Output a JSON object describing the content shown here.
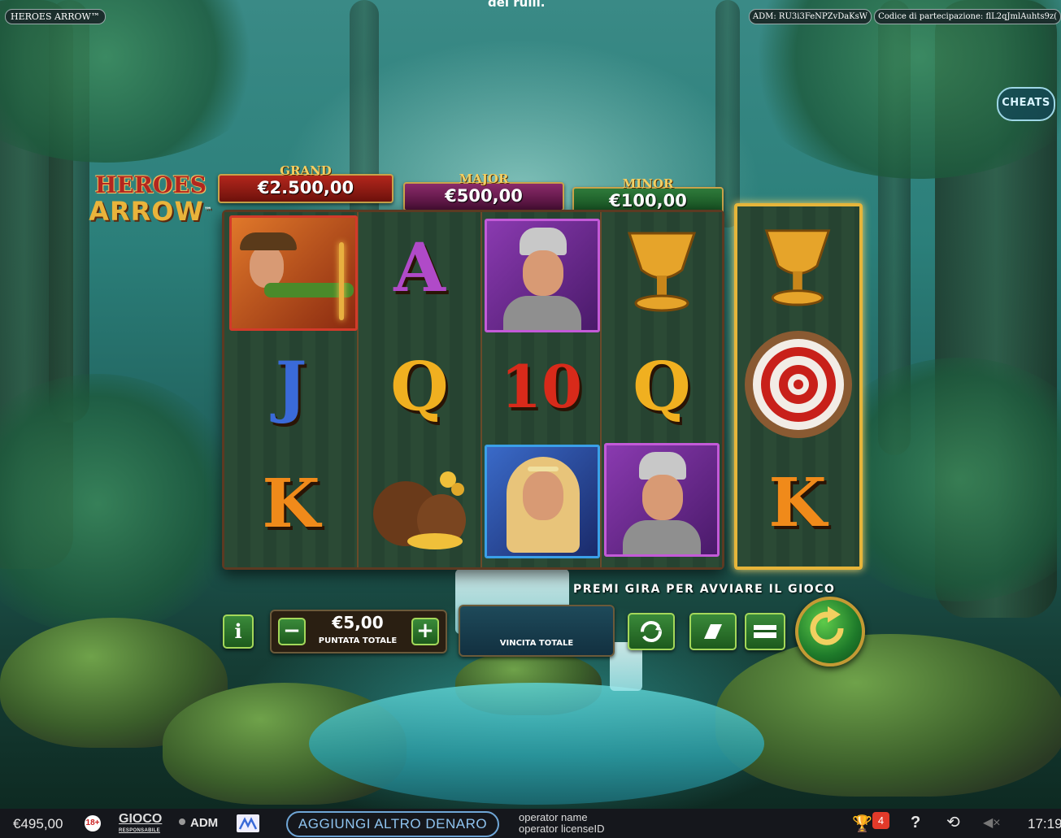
{
  "window": {
    "title": "HEROES ARROW™",
    "adm_code": "ADM: RU3i3FeNPZvDaKsW",
    "participation_code": "Codice di partecipazione: flL2qJmlAuhts9z(",
    "top_message": "del rulli."
  },
  "cheats_label": "CHEATS",
  "logo": {
    "line1": "HEROES",
    "line2": "ARROW"
  },
  "jackpots": [
    {
      "name": "GRAND",
      "value": "€2.500,00",
      "color": "#8e1a12"
    },
    {
      "name": "MAJOR",
      "value": "€500,00",
      "color": "#6a1a4a"
    },
    {
      "name": "MINOR",
      "value": "€100,00",
      "color": "#1f5a2a"
    }
  ],
  "reels": {
    "grid": [
      [
        "archer",
        "A",
        "knight",
        "chalice"
      ],
      [
        "J",
        "Q",
        "10",
        "Q"
      ],
      [
        "K",
        "money-bags",
        "lady",
        "knight"
      ]
    ],
    "extra_reel": [
      "chalice",
      "target",
      "K"
    ]
  },
  "controls": {
    "info_label": "i",
    "stake_value": "€5,00",
    "stake_label": "PUNTATA TOTALE",
    "win_label": "VINCITA TOTALE",
    "prompt": "PREMI GIRA PER AVVIARE IL GIOCO"
  },
  "footer": {
    "balance": "€495,00",
    "age": "18+",
    "gioco": "GIOCO",
    "gioco_sub": "RESPONSABILE",
    "adm": "ADM",
    "add_money": "AGGIUNGI ALTRO DENARO",
    "operator_name": "operator name",
    "operator_license": "operator licenseID",
    "notifications": "4",
    "help": "?",
    "time": "17:19"
  }
}
